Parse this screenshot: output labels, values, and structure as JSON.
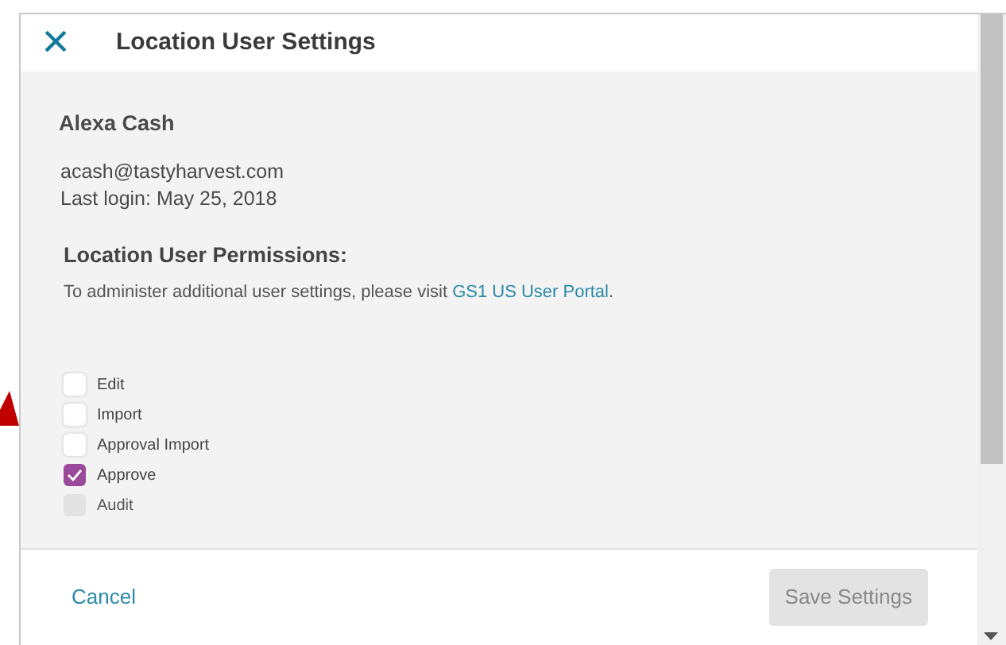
{
  "dialog": {
    "title": "Location User Settings",
    "close": "×"
  },
  "user": {
    "name": "Alexa Cash",
    "email": "acash@tastyharvest.com",
    "last_login": "Last login: May 25, 2018"
  },
  "permissions": {
    "heading": "Location User Permissions:",
    "note_before": "To administer additional user settings, please visit ",
    "link": "GS1 US User Portal",
    "note_after": ".",
    "items": [
      {
        "label": "Edit",
        "checked": false,
        "disabled": false
      },
      {
        "label": "Import",
        "checked": false,
        "disabled": false
      },
      {
        "label": "Approval Import",
        "checked": false,
        "disabled": false
      },
      {
        "label": "Approve",
        "checked": true,
        "disabled": false
      },
      {
        "label": "Audit",
        "checked": false,
        "disabled": true
      }
    ]
  },
  "footer": {
    "cancel": "Cancel",
    "save": {
      "label": "Save Settings",
      "disabled": true
    }
  }
}
